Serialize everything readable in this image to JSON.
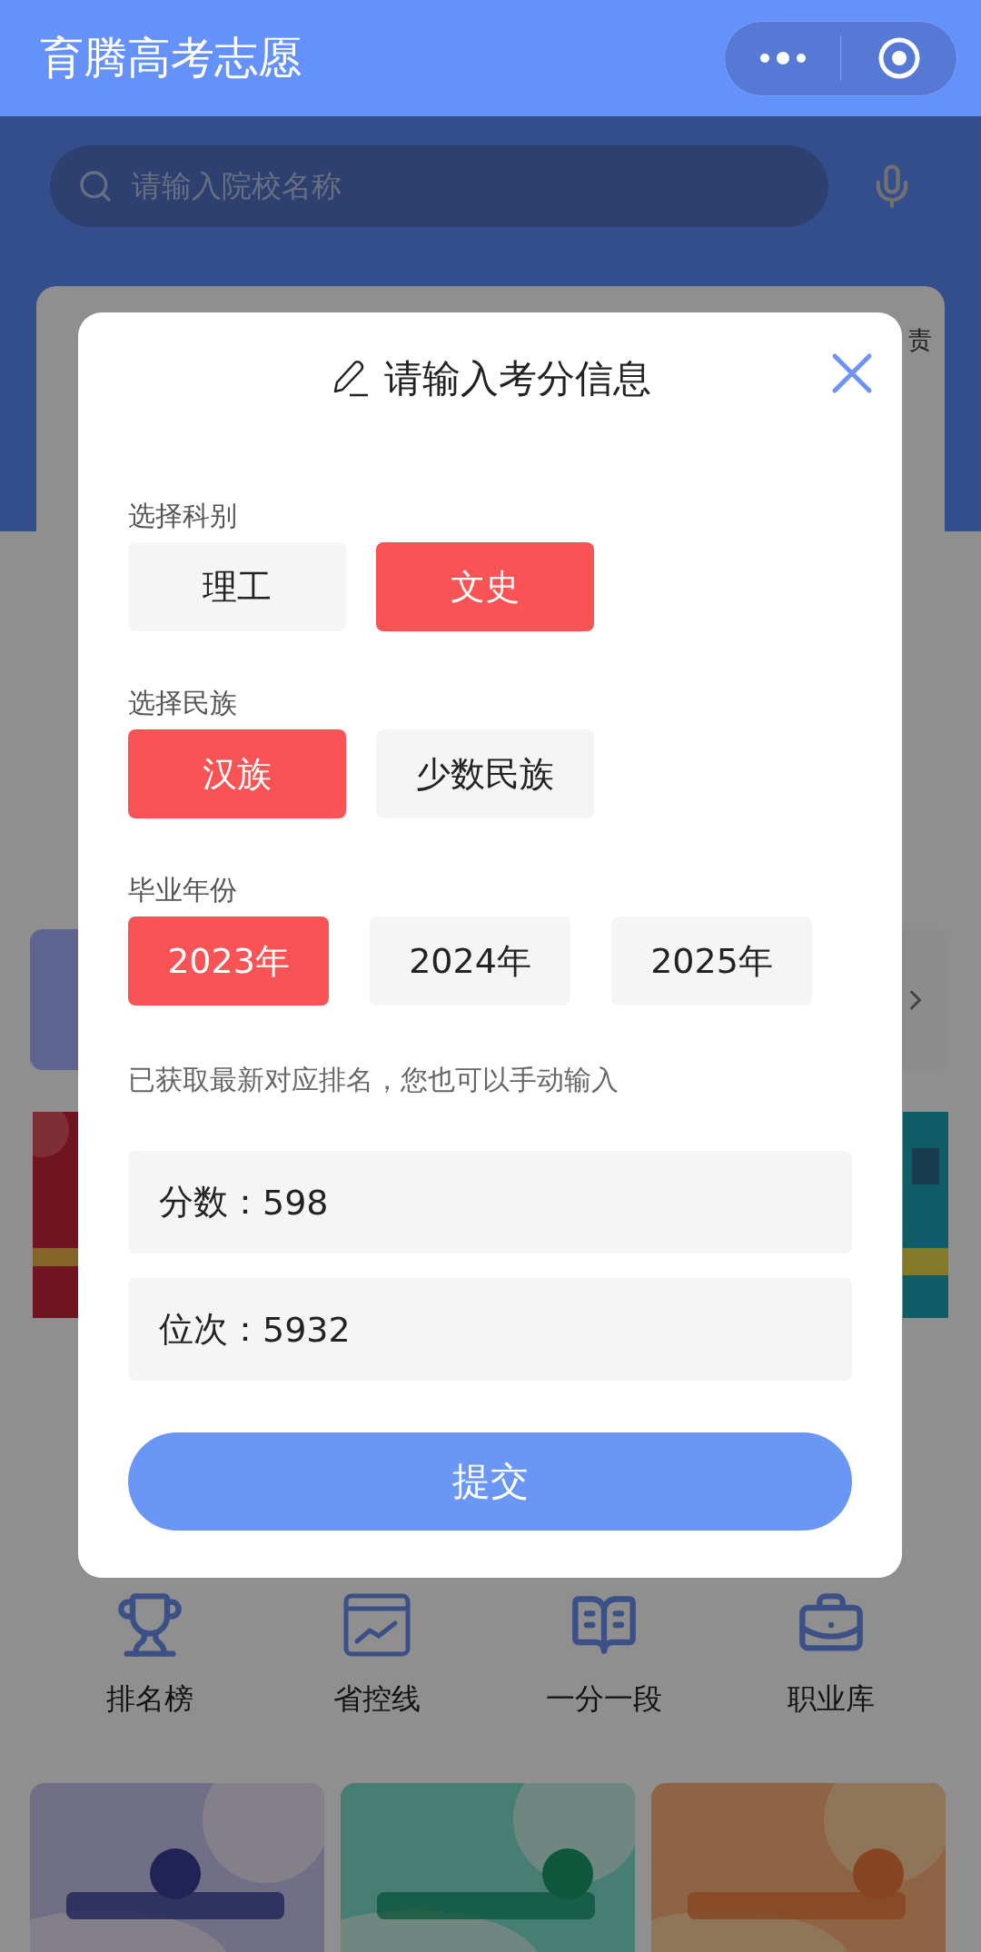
{
  "header": {
    "title": "育腾高考志愿"
  },
  "search": {
    "placeholder": "请输入院校名称"
  },
  "card": {
    "label": "责"
  },
  "shortcuts": [
    {
      "kind": "trophy",
      "label": "排名榜"
    },
    {
      "kind": "chart",
      "label": "省控线"
    },
    {
      "kind": "book",
      "label": "一分一段"
    },
    {
      "kind": "briefcase",
      "label": "职业库"
    }
  ],
  "dialog": {
    "title": "请输入考分信息",
    "sections": [
      {
        "label": "选择科别",
        "options": [
          {
            "label": "理工",
            "selected": false
          },
          {
            "label": "文史",
            "selected": true
          }
        ]
      },
      {
        "label": "选择民族",
        "options": [
          {
            "label": "汉族",
            "selected": true
          },
          {
            "label": "少数民族",
            "selected": false
          }
        ]
      },
      {
        "label": "毕业年份",
        "options": [
          {
            "label": "2023年",
            "selected": true
          },
          {
            "label": "2024年",
            "selected": false
          },
          {
            "label": "2025年",
            "selected": false
          }
        ]
      }
    ],
    "hint": "已获取最新对应排名，您也可以手动输入",
    "fields": [
      {
        "label": "分数：",
        "value": "598"
      },
      {
        "label": "位次：",
        "value": "5932"
      }
    ],
    "submit": "提交"
  }
}
